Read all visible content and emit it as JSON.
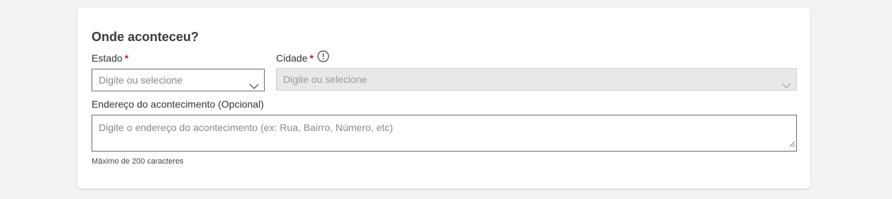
{
  "section": {
    "title": "Onde aconteceu?"
  },
  "estado": {
    "label": "Estado",
    "required_mark": "*",
    "placeholder": "Digite ou selecione",
    "value": ""
  },
  "cidade": {
    "label": "Cidade",
    "required_mark": "*",
    "placeholder": "Digite ou selecione",
    "value": "",
    "disabled": true,
    "info_icon": "info-circle-icon"
  },
  "endereco": {
    "label": "Endereço do acontecimento (Opcional)",
    "placeholder": "Digite o endereço do acontecimento (ex: Rua, Bairro, Número, etc)",
    "value": "",
    "hint": "Máximo de 200 caracteres"
  },
  "colors": {
    "page_background": "#f3f3f3",
    "card_background": "#ffffff",
    "required": "#c4122f",
    "disabled_field": "#e8e8e8"
  },
  "icons": {
    "dropdown": "chevron-down-icon",
    "resize": "resize-handle-icon"
  }
}
